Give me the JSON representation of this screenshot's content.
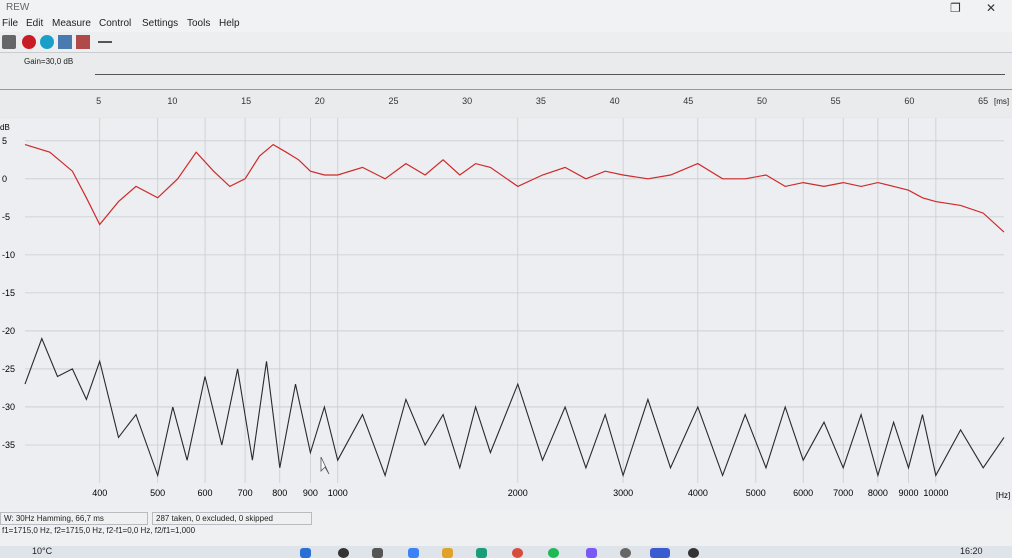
{
  "app": {
    "title": "REW",
    "restore_glyph": "❐",
    "close_glyph": "✕"
  },
  "menu": [
    "File",
    "Edit",
    "Measure",
    "Control",
    "Settings",
    "Tools",
    "Help"
  ],
  "toolbar": {
    "icons": [
      "save-icon",
      "record-icon",
      "meter-icon",
      "level-icon",
      "level-icon-2",
      "pin-icon"
    ]
  },
  "gain": {
    "label": "Gain=30,0 dB"
  },
  "time_axis": {
    "ticks": [
      "5",
      "10",
      "15",
      "20",
      "25",
      "30",
      "35",
      "40",
      "45",
      "50",
      "55",
      "60",
      "65"
    ],
    "unit": "[ms]"
  },
  "colors": {
    "red_trace": "#cf2a2a",
    "black_trace": "#2a2a2a",
    "grid": "#c9ccd0",
    "plot_bg": "#eceef1"
  },
  "chart_data": {
    "type": "line",
    "y_axis": {
      "unit": "dB",
      "ticks": [
        "5",
        "0",
        "-5",
        "-10",
        "-15",
        "-20",
        "-25",
        "-30",
        "-35"
      ],
      "range": [
        -40,
        8
      ]
    },
    "x_axis": {
      "unit": "[Hz]",
      "scale": "log",
      "ticks": [
        "400",
        "500",
        "600",
        "700",
        "800",
        "900",
        "1000",
        "2000",
        "3000",
        "4000",
        "5000",
        "6000",
        "7000",
        "8000",
        "9000",
        "10000"
      ],
      "range": [
        300,
        13000
      ]
    },
    "series": [
      {
        "role": "red",
        "x": [
          300,
          330,
          360,
          380,
          400,
          430,
          460,
          500,
          540,
          580,
          620,
          660,
          700,
          740,
          780,
          820,
          860,
          900,
          950,
          1000,
          1100,
          1200,
          1300,
          1400,
          1500,
          1600,
          1700,
          1800,
          2000,
          2200,
          2400,
          2600,
          2800,
          3000,
          3300,
          3600,
          4000,
          4400,
          4800,
          5200,
          5600,
          6000,
          6500,
          7000,
          7500,
          8000,
          8500,
          9000,
          9500,
          10000,
          11000,
          12000,
          13000
        ],
        "y": [
          4.5,
          3.5,
          1,
          -2.5,
          -6,
          -3,
          -1,
          -2.5,
          0,
          3.5,
          1,
          -1,
          0,
          3,
          4.5,
          3.5,
          2.5,
          1,
          0.5,
          0.5,
          1.5,
          0,
          2,
          0.5,
          2.5,
          0.5,
          2,
          1.5,
          -1,
          0.5,
          1.5,
          0,
          1,
          0.5,
          0,
          0.5,
          2,
          0,
          0,
          0.5,
          -1,
          -0.5,
          -1,
          -0.5,
          -1,
          -0.5,
          -1,
          -1.5,
          -2.5,
          -3,
          -3.5,
          -4.5,
          -7
        ]
      },
      {
        "role": "black",
        "x": [
          300,
          320,
          340,
          360,
          380,
          400,
          430,
          460,
          500,
          530,
          560,
          600,
          640,
          680,
          720,
          760,
          800,
          850,
          900,
          950,
          1000,
          1100,
          1200,
          1300,
          1400,
          1500,
          1600,
          1700,
          1800,
          2000,
          2200,
          2400,
          2600,
          2800,
          3000,
          3300,
          3600,
          4000,
          4400,
          4800,
          5200,
          5600,
          6000,
          6500,
          7000,
          7500,
          8000,
          8500,
          9000,
          9500,
          10000,
          11000,
          12000,
          13000
        ],
        "y": [
          -27,
          -21,
          -26,
          -25,
          -29,
          -24,
          -34,
          -31,
          -39,
          -30,
          -37,
          -26,
          -35,
          -25,
          -37,
          -24,
          -38,
          -27,
          -36,
          -30,
          -37,
          -31,
          -39,
          -29,
          -35,
          -31,
          -38,
          -30,
          -36,
          -27,
          -37,
          -30,
          -38,
          -31,
          -39,
          -29,
          -38,
          -30,
          -39,
          -31,
          -38,
          -30,
          -37,
          -32,
          -38,
          -31,
          -39,
          -32,
          -38,
          -31,
          -39,
          -33,
          -38,
          -34
        ]
      }
    ]
  },
  "status": {
    "cell1": "W: 30Hz Hamming, 66,7 ms",
    "cell2": "287 taken, 0 excluded, 0 skipped",
    "line2": "f1=1715,0 Hz, f2=1715,0 Hz, f2-f1=0,0 Hz, f2/f1=1,000"
  },
  "taskbar": {
    "temp": "10°C",
    "time": "16:20"
  }
}
